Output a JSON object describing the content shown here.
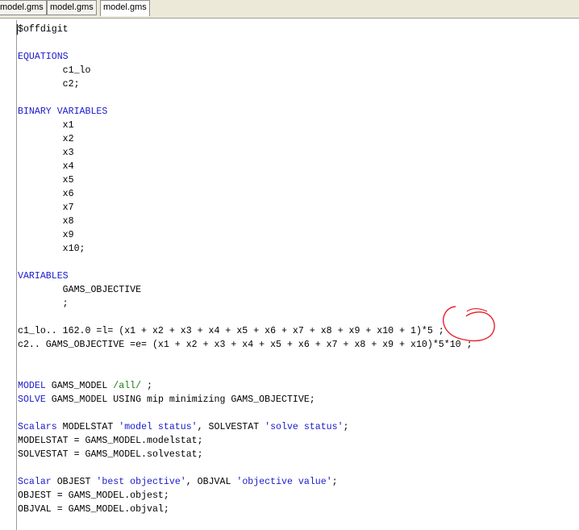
{
  "tabs": [
    {
      "label": "model.gms",
      "active": false
    },
    {
      "label": "model.gms",
      "active": false
    },
    {
      "label": "model.gms",
      "active": true
    }
  ],
  "code": {
    "lines": [
      "$offdigit",
      "",
      "EQUATIONS",
      "        c1_lo",
      "        c2;",
      "",
      "BINARY VARIABLES",
      "        x1",
      "        x2",
      "        x3",
      "        x4",
      "        x5",
      "        x6",
      "        x7",
      "        x8",
      "        x9",
      "        x10;",
      "",
      "VARIABLES",
      "        GAMS_OBJECTIVE",
      "        ;",
      "",
      "c1_lo.. 162.0 =l= (x1 + x2 + x3 + x4 + x5 + x6 + x7 + x8 + x9 + x10 + 1)*5 ;",
      "c2.. GAMS_OBJECTIVE =e= (x1 + x2 + x3 + x4 + x5 + x6 + x7 + x8 + x9 + x10)*5*10 ;",
      "",
      "",
      "MODEL GAMS_MODEL /all/ ;",
      "SOLVE GAMS_MODEL USING mip minimizing GAMS_OBJECTIVE;",
      "",
      "Scalars MODELSTAT 'model status', SOLVESTAT 'solve status';",
      "MODELSTAT = GAMS_MODEL.modelstat;",
      "SOLVESTAT = GAMS_MODEL.solvestat;",
      "",
      "Scalar OBJEST 'best objective', OBJVAL 'objective value';",
      "OBJEST = GAMS_MODEL.objest;",
      "OBJVAL = GAMS_MODEL.objval;"
    ]
  },
  "colors": {
    "keyword": "#1a1acd",
    "string": "#1a1acd",
    "set_slash": "#1a7a1a",
    "annotation": "#e8202a"
  }
}
